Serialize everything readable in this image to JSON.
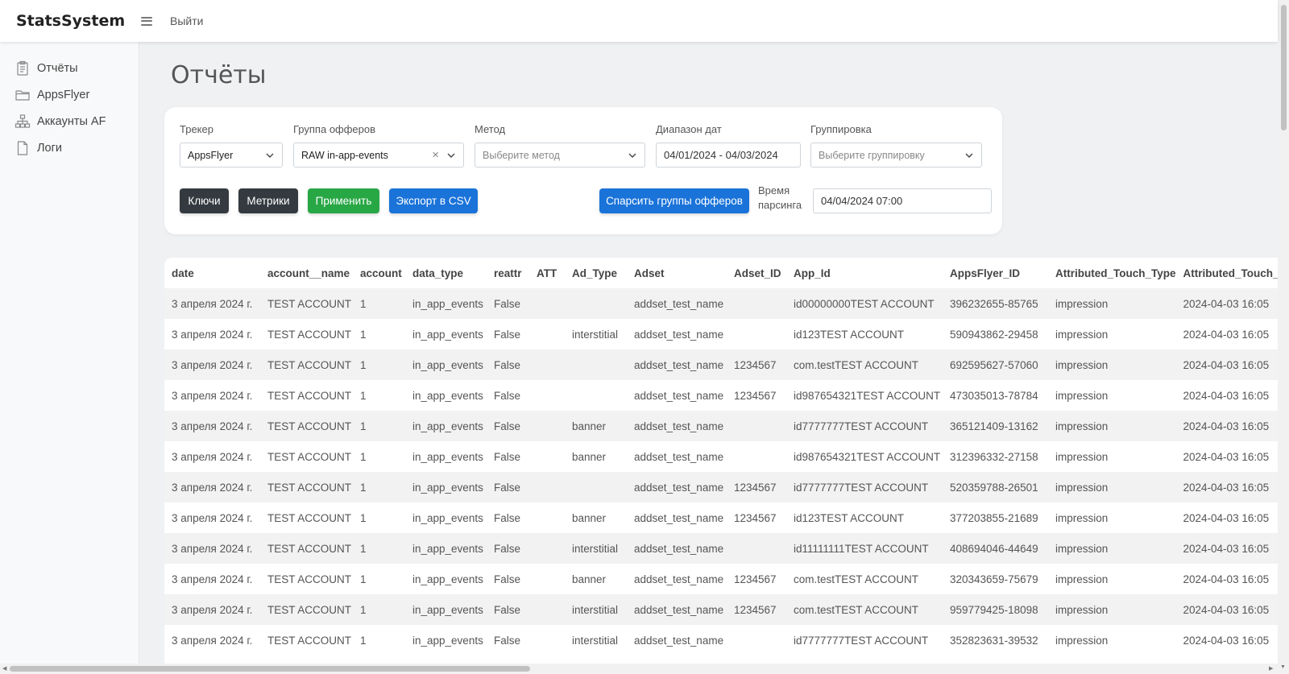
{
  "app": {
    "brand": "StatsSystem",
    "logout": "Выйти"
  },
  "sidebar": {
    "items": [
      {
        "label": "Отчёты",
        "icon": "report-icon"
      },
      {
        "label": "AppsFlyer",
        "icon": "folder-icon"
      },
      {
        "label": "Аккаунты AF",
        "icon": "sitemap-icon"
      },
      {
        "label": "Логи",
        "icon": "file-icon"
      }
    ]
  },
  "page": {
    "title": "Отчёты"
  },
  "filters": {
    "tracker": {
      "label": "Трекер",
      "value": "AppsFlyer"
    },
    "offer_group": {
      "label": "Группа офферов",
      "value": "RAW in-app-events"
    },
    "method": {
      "label": "Метод",
      "placeholder": "Выберите метод"
    },
    "date_range": {
      "label": "Диапазон дат",
      "value": "04/01/2024 - 04/03/2024"
    },
    "grouping": {
      "label": "Группировка",
      "placeholder": "Выберите группировку"
    }
  },
  "buttons": {
    "keys": "Ключи",
    "metrics": "Метрики",
    "apply": "Применить",
    "export": "Экспорт в CSV",
    "parse": "Спарсить группы офферов"
  },
  "parse_time": {
    "label_line1": "Время",
    "label_line2": "парсинга",
    "value": "04/04/2024 07:00"
  },
  "table": {
    "columns": [
      "date",
      "account__name",
      "account",
      "data_type",
      "reattr",
      "ATT",
      "Ad_Type",
      "Adset",
      "Adset_ID",
      "App_Id",
      "AppsFlyer_ID",
      "Attributed_Touch_Type",
      "Attributed_Touch_Time"
    ],
    "rows": [
      [
        "3 апреля 2024 г.",
        "TEST ACCOUNT",
        "1",
        "in_app_events",
        "False",
        "",
        "",
        "addset_test_name",
        "",
        "id00000000TEST ACCOUNT",
        "396232655-85765",
        "impression",
        "2024-04-03 16:05"
      ],
      [
        "3 апреля 2024 г.",
        "TEST ACCOUNT",
        "1",
        "in_app_events",
        "False",
        "",
        "interstitial",
        "addset_test_name",
        "",
        "id123TEST ACCOUNT",
        "590943862-29458",
        "impression",
        "2024-04-03 16:05"
      ],
      [
        "3 апреля 2024 г.",
        "TEST ACCOUNT",
        "1",
        "in_app_events",
        "False",
        "",
        "",
        "addset_test_name",
        "1234567",
        "com.testTEST ACCOUNT",
        "692595627-57060",
        "impression",
        "2024-04-03 16:05"
      ],
      [
        "3 апреля 2024 г.",
        "TEST ACCOUNT",
        "1",
        "in_app_events",
        "False",
        "",
        "",
        "addset_test_name",
        "1234567",
        "id987654321TEST ACCOUNT",
        "473035013-78784",
        "impression",
        "2024-04-03 16:05"
      ],
      [
        "3 апреля 2024 г.",
        "TEST ACCOUNT",
        "1",
        "in_app_events",
        "False",
        "",
        "banner",
        "addset_test_name",
        "",
        "id7777777TEST ACCOUNT",
        "365121409-13162",
        "impression",
        "2024-04-03 16:05"
      ],
      [
        "3 апреля 2024 г.",
        "TEST ACCOUNT",
        "1",
        "in_app_events",
        "False",
        "",
        "banner",
        "addset_test_name",
        "",
        "id987654321TEST ACCOUNT",
        "312396332-27158",
        "impression",
        "2024-04-03 16:05"
      ],
      [
        "3 апреля 2024 г.",
        "TEST ACCOUNT",
        "1",
        "in_app_events",
        "False",
        "",
        "",
        "addset_test_name",
        "1234567",
        "id7777777TEST ACCOUNT",
        "520359788-26501",
        "impression",
        "2024-04-03 16:05"
      ],
      [
        "3 апреля 2024 г.",
        "TEST ACCOUNT",
        "1",
        "in_app_events",
        "False",
        "",
        "banner",
        "addset_test_name",
        "1234567",
        "id123TEST ACCOUNT",
        "377203855-21689",
        "impression",
        "2024-04-03 16:05"
      ],
      [
        "3 апреля 2024 г.",
        "TEST ACCOUNT",
        "1",
        "in_app_events",
        "False",
        "",
        "interstitial",
        "addset_test_name",
        "",
        "id11111111TEST ACCOUNT",
        "408694046-44649",
        "impression",
        "2024-04-03 16:05"
      ],
      [
        "3 апреля 2024 г.",
        "TEST ACCOUNT",
        "1",
        "in_app_events",
        "False",
        "",
        "banner",
        "addset_test_name",
        "1234567",
        "com.testTEST ACCOUNT",
        "320343659-75679",
        "impression",
        "2024-04-03 16:05"
      ],
      [
        "3 апреля 2024 г.",
        "TEST ACCOUNT",
        "1",
        "in_app_events",
        "False",
        "",
        "interstitial",
        "addset_test_name",
        "1234567",
        "com.testTEST ACCOUNT",
        "959779425-18098",
        "impression",
        "2024-04-03 16:05"
      ],
      [
        "3 апреля 2024 г.",
        "TEST ACCOUNT",
        "1",
        "in_app_events",
        "False",
        "",
        "interstitial",
        "addset_test_name",
        "",
        "id7777777TEST ACCOUNT",
        "352823631-39532",
        "impression",
        "2024-04-03 16:05"
      ]
    ]
  },
  "colors": {
    "green": "#28a745",
    "blue": "#1a73d9",
    "dark": "#343a40"
  }
}
